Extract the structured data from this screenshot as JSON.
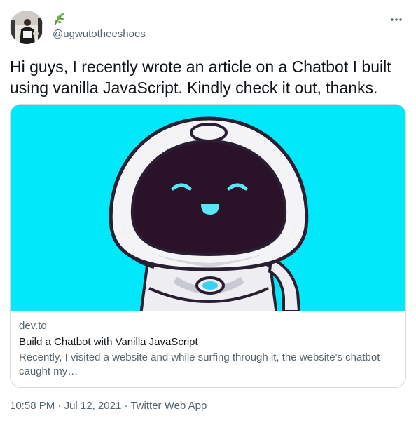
{
  "author": {
    "display_name_icon": "herb-emoji-icon",
    "handle": "@ugwutotheeshoes"
  },
  "tweet": {
    "text": "Hi guys, I recently wrote an article on a Chatbot I built using vanilla JavaScript. Kindly check it out, thanks."
  },
  "card": {
    "domain": "dev.to",
    "title": "Build a Chatbot with Vanilla JavaScript",
    "description": "Recently, I visited a website and while surfing through it, the website's chatbot caught my…",
    "image_background": "#00e8f9",
    "image_icon": "waving-robot-illustration"
  },
  "meta": {
    "time": "10:58 PM",
    "separator": " · ",
    "date": "Jul 12, 2021",
    "source": "Twitter Web App"
  },
  "colors": {
    "text": "#0f1419",
    "secondary": "#536471",
    "border": "#cfd9de"
  }
}
